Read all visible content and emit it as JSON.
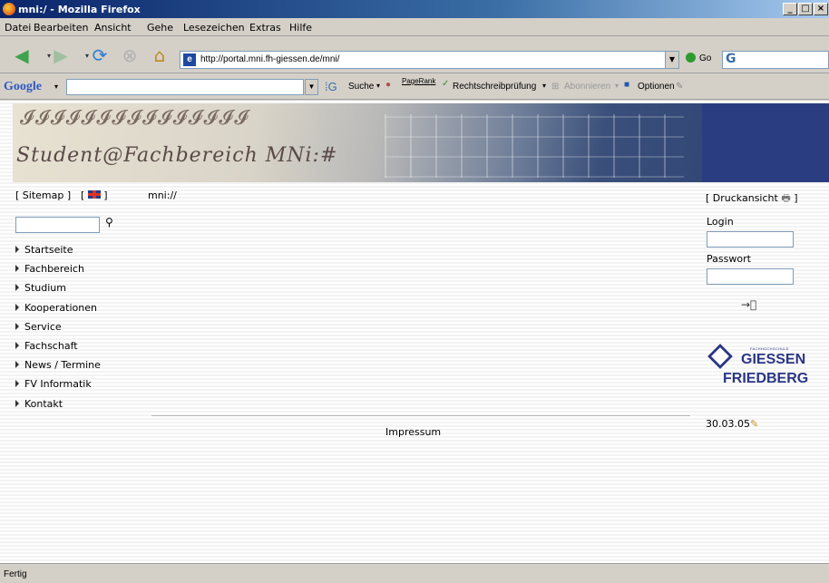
{
  "window": {
    "title": "mni:/ - Mozilla Firefox",
    "minimize": "_",
    "maximize": "□",
    "close": "×"
  },
  "menu": [
    "Datei",
    "Bearbeiten",
    "Ansicht",
    "Gehe",
    "Lesezeichen",
    "Extras",
    "Hilfe"
  ],
  "nav": {
    "url": "http://portal.mni.fh-giessen.de/mni/",
    "go_label": "Go",
    "search_icon": "G"
  },
  "google_toolbar": {
    "logo": "Google",
    "search_label": "Suche",
    "pagerank": "PageRank",
    "spellcheck": "Rechtschreibprüfung",
    "subscribe": "Abonnieren",
    "options": "Optionen"
  },
  "banner": {
    "text": "Student@Fachbereich MNi:#"
  },
  "page": {
    "sitemap": "[ Sitemap ]",
    "flag_open": "[",
    "flag_close": "]",
    "breadcrumb": "mni://",
    "print_view": "[ Druckansicht",
    "print_close": "]",
    "nav_items": [
      "Startseite",
      "Fachbereich",
      "Studium",
      "Kooperationen",
      "Service",
      "Fachschaft",
      "News / Termine",
      "FV Informatik",
      "Kontakt"
    ],
    "login_label": "Login",
    "password_label": "Passwort",
    "logo_small": "FACHHOCHSCHULE",
    "logo_line1": "GIESSEN",
    "logo_line2": "FRIEDBERG",
    "footer_link": "Impressum",
    "date": "30.03.05"
  },
  "status": {
    "text": "Fertig"
  },
  "icons": [
    "back-icon",
    "forward-icon",
    "reload-icon",
    "stop-icon",
    "home-icon",
    "search-icon",
    "printer-icon",
    "pencil-icon",
    "login-arrow-icon"
  ]
}
